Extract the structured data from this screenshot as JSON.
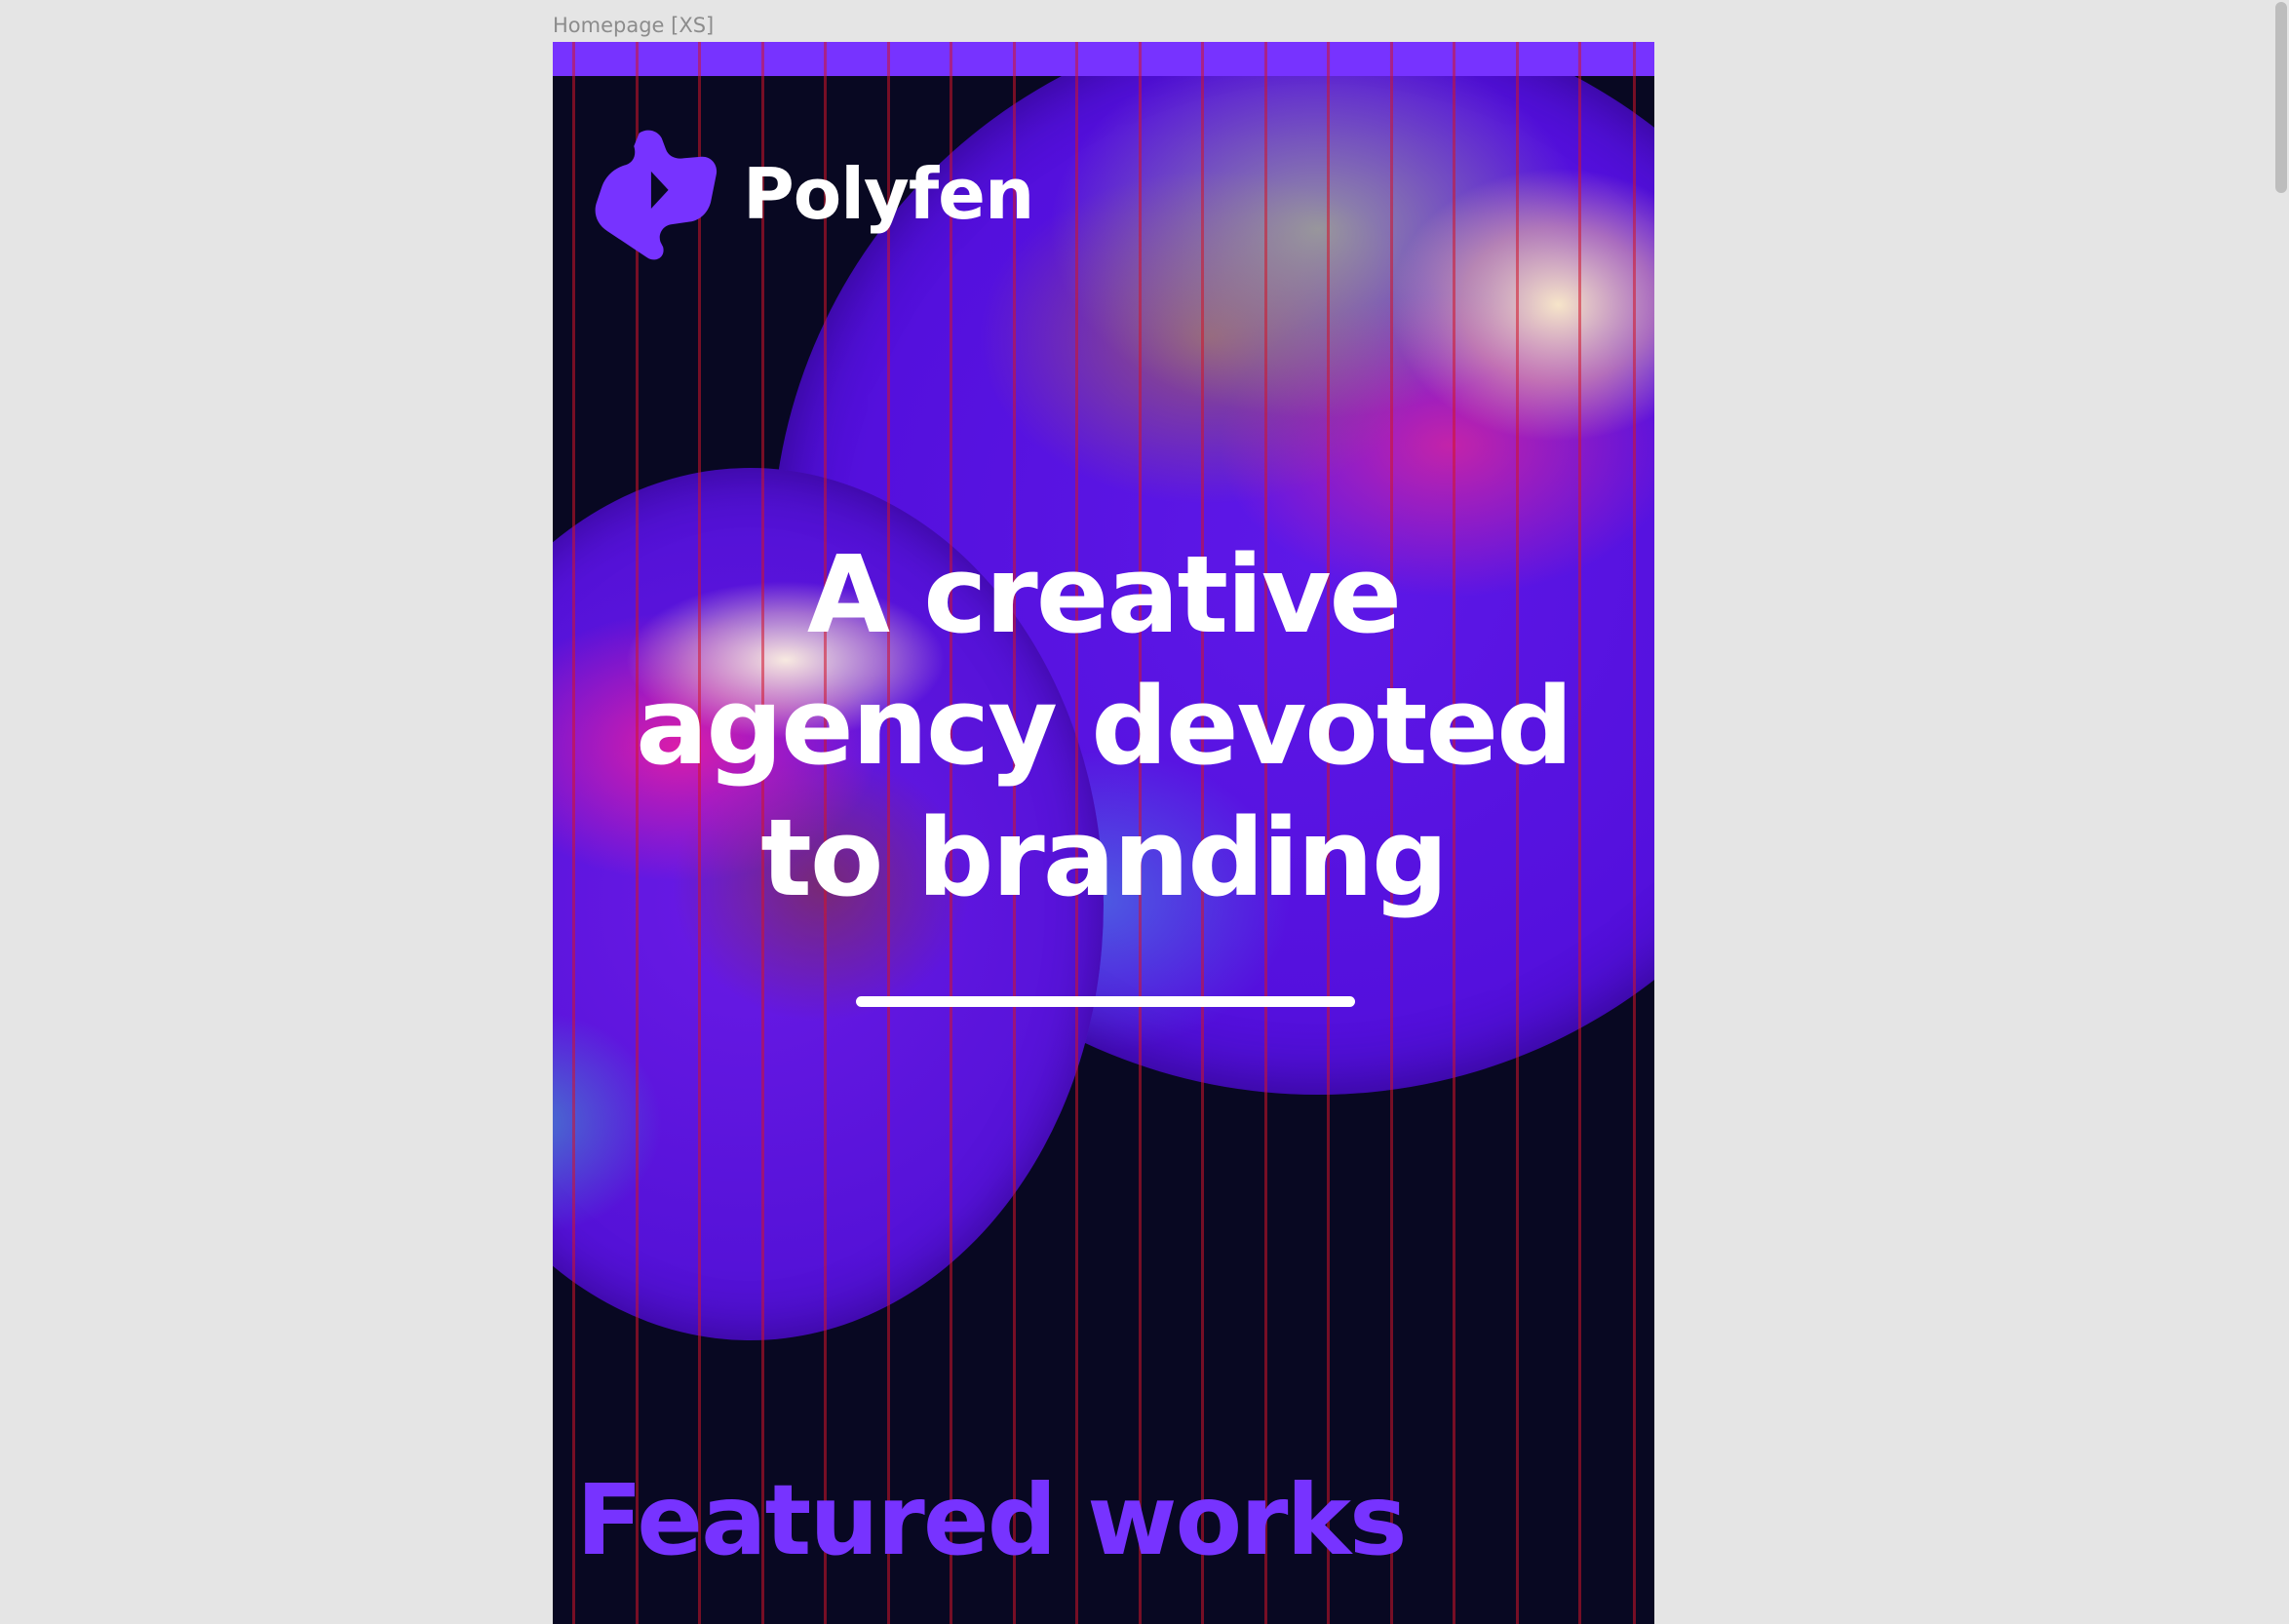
{
  "frame": {
    "label": "Homepage [XS]"
  },
  "brand": {
    "name": "Polyfen",
    "logo_icon": "polyfen-logo-mark-icon",
    "accent_color": "#7733ff",
    "background_color": "#080822"
  },
  "hero": {
    "headline_lines": [
      "A creative",
      "agency devoted",
      "to branding"
    ]
  },
  "featured": {
    "title": "Featured works"
  }
}
